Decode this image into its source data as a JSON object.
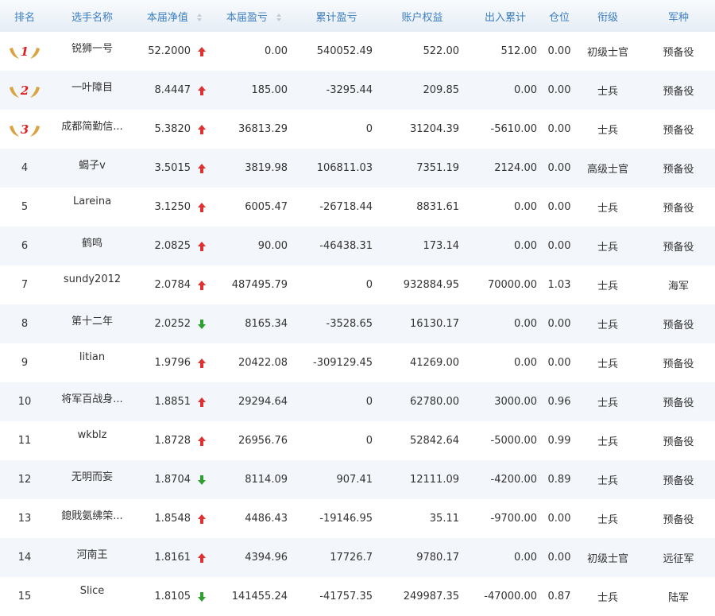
{
  "header": {
    "rank": "排名",
    "name": "选手名称",
    "nav": "本届净值",
    "pnl": "本届盈亏",
    "cum_pnl": "累计盈亏",
    "equity": "账户权益",
    "io": "出入累计",
    "position": "仓位",
    "title": "衔级",
    "branch": "军种"
  },
  "colors": {
    "header_text": "#3d7fc2",
    "up_arrow": "#e03030",
    "down_arrow": "#2ea02e",
    "badge_gold": "#d9a441",
    "badge_number": "#e02020"
  },
  "rows": [
    {
      "rank": "1",
      "name": "锐狮一号",
      "nav": "52.2000",
      "dir": "up",
      "pnl": "0.00",
      "cum": "540052.49",
      "equity": "522.00",
      "io": "512.00",
      "pos": "0.00",
      "title": "初级士官",
      "branch": "预备役"
    },
    {
      "rank": "2",
      "name": "一叶障目",
      "nav": "8.4447",
      "dir": "up",
      "pnl": "185.00",
      "cum": "-3295.44",
      "equity": "209.85",
      "io": "0.00",
      "pos": "0.00",
      "title": "士兵",
      "branch": "预备役"
    },
    {
      "rank": "3",
      "name": "成都简勤信...",
      "nav": "5.3820",
      "dir": "up",
      "pnl": "36813.29",
      "cum": "0",
      "equity": "31204.39",
      "io": "-5610.00",
      "pos": "0.00",
      "title": "士兵",
      "branch": "预备役"
    },
    {
      "rank": "4",
      "name": "蝎子v",
      "nav": "3.5015",
      "dir": "up",
      "pnl": "3819.98",
      "cum": "106811.03",
      "equity": "7351.19",
      "io": "2124.00",
      "pos": "0.00",
      "title": "高级士官",
      "branch": "预备役"
    },
    {
      "rank": "5",
      "name": "Lareina",
      "nav": "3.1250",
      "dir": "up",
      "pnl": "6005.47",
      "cum": "-26718.44",
      "equity": "8831.61",
      "io": "0.00",
      "pos": "0.00",
      "title": "士兵",
      "branch": "预备役"
    },
    {
      "rank": "6",
      "name": "鹤鸣",
      "nav": "2.0825",
      "dir": "up",
      "pnl": "90.00",
      "cum": "-46438.31",
      "equity": "173.14",
      "io": "0.00",
      "pos": "0.00",
      "title": "士兵",
      "branch": "预备役"
    },
    {
      "rank": "7",
      "name": "sundy2012",
      "nav": "2.0784",
      "dir": "up",
      "pnl": "487495.79",
      "cum": "0",
      "equity": "932884.95",
      "io": "70000.00",
      "pos": "1.03",
      "title": "士兵",
      "branch": "海军"
    },
    {
      "rank": "8",
      "name": "第十二年",
      "nav": "2.0252",
      "dir": "down",
      "pnl": "8165.34",
      "cum": "-3528.65",
      "equity": "16130.17",
      "io": "0.00",
      "pos": "0.00",
      "title": "士兵",
      "branch": "预备役"
    },
    {
      "rank": "9",
      "name": "litian",
      "nav": "1.9796",
      "dir": "up",
      "pnl": "20422.08",
      "cum": "-309129.45",
      "equity": "41269.00",
      "io": "0.00",
      "pos": "0.00",
      "title": "士兵",
      "branch": "预备役"
    },
    {
      "rank": "10",
      "name": "将军百战身...",
      "nav": "1.8851",
      "dir": "up",
      "pnl": "29294.64",
      "cum": "0",
      "equity": "62780.00",
      "io": "3000.00",
      "pos": "0.96",
      "title": "士兵",
      "branch": "预备役"
    },
    {
      "rank": "11",
      "name": "wkblz",
      "nav": "1.8728",
      "dir": "up",
      "pnl": "26956.76",
      "cum": "0",
      "equity": "52842.64",
      "io": "-5000.00",
      "pos": "0.99",
      "title": "士兵",
      "branch": "预备役"
    },
    {
      "rank": "12",
      "name": "无明而妄",
      "nav": "1.8704",
      "dir": "down",
      "pnl": "8114.09",
      "cum": "907.41",
      "equity": "12111.09",
      "io": "-4200.00",
      "pos": "0.89",
      "title": "士兵",
      "branch": "预备役"
    },
    {
      "rank": "13",
      "name": "鎴戝氨绋筞...",
      "nav": "1.8548",
      "dir": "up",
      "pnl": "4486.43",
      "cum": "-19146.95",
      "equity": "35.11",
      "io": "-9700.00",
      "pos": "0.00",
      "title": "士兵",
      "branch": "预备役"
    },
    {
      "rank": "14",
      "name": "河南王",
      "nav": "1.8161",
      "dir": "up",
      "pnl": "4394.96",
      "cum": "17726.7",
      "equity": "9780.17",
      "io": "0.00",
      "pos": "0.00",
      "title": "初级士官",
      "branch": "远征军"
    },
    {
      "rank": "15",
      "name": "Slice",
      "nav": "1.8105",
      "dir": "down",
      "pnl": "141455.24",
      "cum": "-41757.35",
      "equity": "249987.35",
      "io": "-47000.00",
      "pos": "0.87",
      "title": "士兵",
      "branch": "陆军"
    }
  ]
}
